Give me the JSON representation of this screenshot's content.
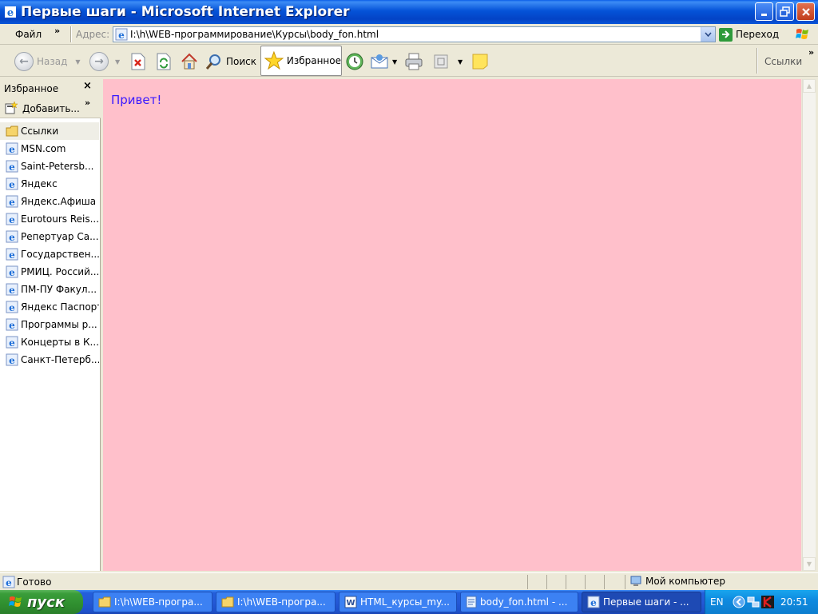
{
  "window": {
    "title": "Первые шаги - Microsoft Internet Explorer"
  },
  "menu": {
    "file": "Файл"
  },
  "address": {
    "label": "Адрес:",
    "url": "I:\\h\\WEB-программирование\\Курсы\\body_fon.html",
    "go_label": "Переход"
  },
  "toolbar": {
    "back_label": "Назад",
    "search_label": "Поиск",
    "favorites_label": "Избранное",
    "links_label": "Ссылки"
  },
  "sidebar": {
    "title": "Избранное",
    "add_label": "Добавить...",
    "items": [
      {
        "label": "Ссылки",
        "type": "folder"
      },
      {
        "label": "MSN.com",
        "type": "link"
      },
      {
        "label": "Saint-Petersb...",
        "type": "link"
      },
      {
        "label": "Яндекс",
        "type": "link"
      },
      {
        "label": "Яндекс.Афиша",
        "type": "link"
      },
      {
        "label": "Eurotours Reis...",
        "type": "link"
      },
      {
        "label": "Репертуар Са...",
        "type": "link"
      },
      {
        "label": "Государствен...",
        "type": "link"
      },
      {
        "label": "РМИЦ. Россий...",
        "type": "link"
      },
      {
        "label": "ПМ-ПУ  Факул...",
        "type": "link"
      },
      {
        "label": "Яндекс Паспорт",
        "type": "link"
      },
      {
        "label": "Программы р...",
        "type": "link"
      },
      {
        "label": "Концерты в К...",
        "type": "link"
      },
      {
        "label": "Санкт-Петерб...",
        "type": "link"
      }
    ]
  },
  "page": {
    "greeting": "Привет!",
    "background_color": "#FFC0CB",
    "text_color": "#3A19FF"
  },
  "status": {
    "text": "Готово",
    "zone": "Мой компьютер"
  },
  "taskbar": {
    "start_label": "пуск",
    "tasks": [
      {
        "label": "I:\\h\\WEB-програ...",
        "icon": "folder-icon"
      },
      {
        "label": "I:\\h\\WEB-програ...",
        "icon": "folder-icon"
      },
      {
        "label": "HTML_курсы_my...",
        "icon": "word-icon"
      },
      {
        "label": "body_fon.html - ...",
        "icon": "notepad-icon"
      },
      {
        "label": "Первые шаги - ...",
        "icon": "ie-icon"
      }
    ],
    "language": "EN",
    "clock": "20:51"
  }
}
